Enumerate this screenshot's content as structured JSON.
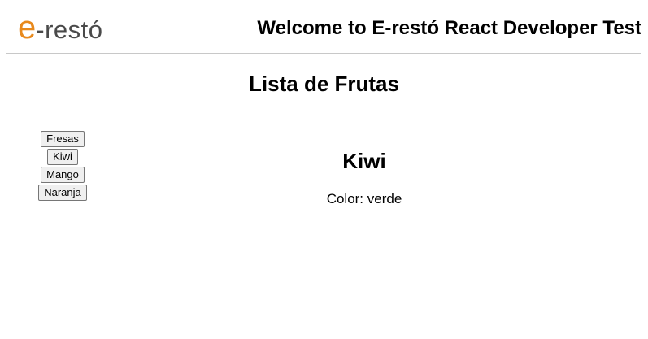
{
  "header": {
    "logo": {
      "e": "e",
      "rest": "-restó",
      "colors": {
        "e": "#e8891c",
        "text": "#4a4a4a"
      }
    },
    "title": "Welcome to E-restó React Developer Test"
  },
  "main": {
    "title": "Lista de Frutas",
    "fruits": [
      {
        "label": "Fresas"
      },
      {
        "label": "Kiwi"
      },
      {
        "label": "Mango"
      },
      {
        "label": "Naranja"
      }
    ],
    "selected": {
      "name": "Kiwi",
      "color_label": "Color:",
      "color_value": "verde"
    }
  }
}
